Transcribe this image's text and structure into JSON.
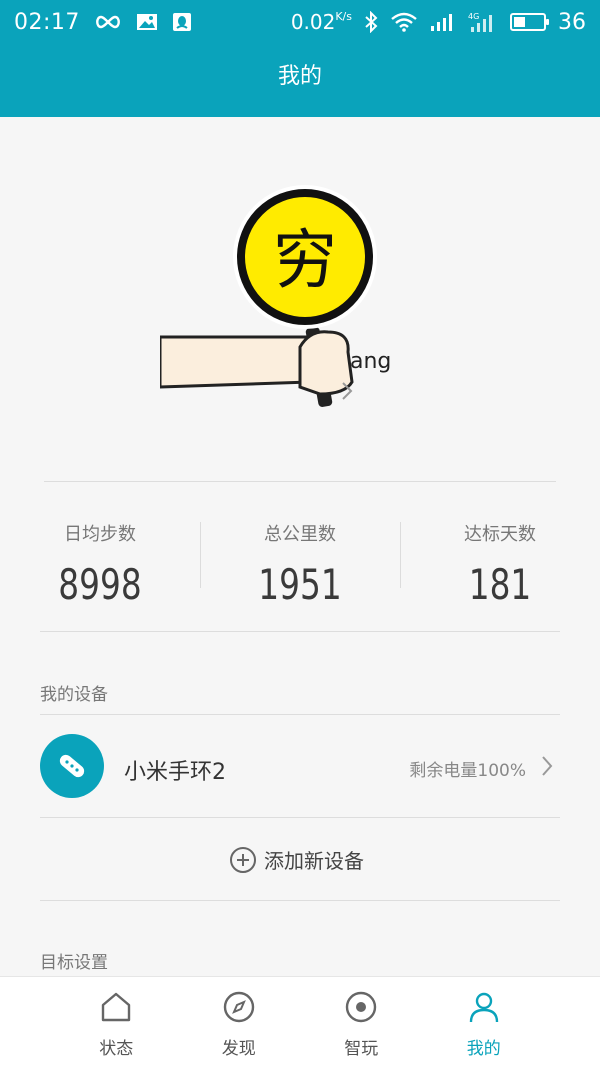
{
  "status_bar": {
    "time": "02:17",
    "speed": "0.02",
    "speed_unit": "K/s",
    "network": "4G",
    "battery": "36"
  },
  "header": {
    "title": "我的"
  },
  "profile": {
    "username": "ang",
    "avatar_sign_text": "穷"
  },
  "stats": [
    {
      "label": "日均步数",
      "value": "8998"
    },
    {
      "label": "总公里数",
      "value": "1951"
    },
    {
      "label": "达标天数",
      "value": "181"
    }
  ],
  "devices_section": {
    "title": "我的设备",
    "device": {
      "name": "小米手环2",
      "battery": "剩余电量100%"
    },
    "add_label": "添加新设备"
  },
  "goal_section": {
    "title": "目标设置"
  },
  "bottom_nav": [
    {
      "label": "状态",
      "icon": "home-icon"
    },
    {
      "label": "发现",
      "icon": "compass-icon"
    },
    {
      "label": "智玩",
      "icon": "target-icon"
    },
    {
      "label": "我的",
      "icon": "person-icon",
      "active": true
    }
  ],
  "colors": {
    "accent": "#0aa3bb",
    "background": "#f6f6f6",
    "sign_yellow": "#ffeb00"
  }
}
